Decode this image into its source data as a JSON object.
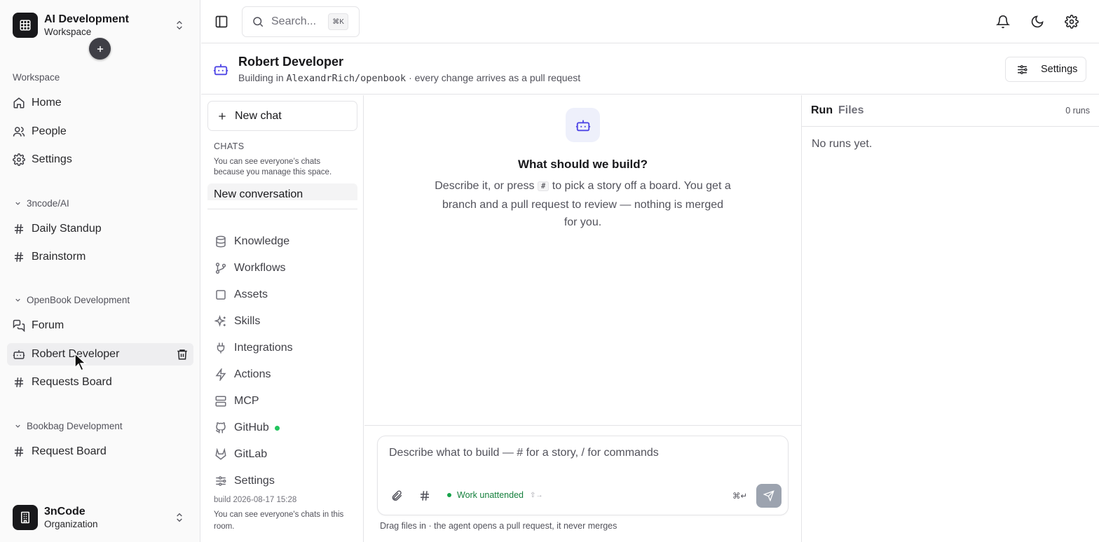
{
  "workspace": {
    "name": "AI Development",
    "type": "Workspace"
  },
  "sidebar": {
    "section_label": "Workspace",
    "items": [
      {
        "label": "Home",
        "icon": "home-icon"
      },
      {
        "label": "People",
        "icon": "people-icon"
      },
      {
        "label": "Settings",
        "icon": "gear-icon"
      }
    ],
    "groups": [
      {
        "label": "3ncode/AI",
        "items": [
          {
            "label": "Daily Standup",
            "icon": "hash-icon"
          },
          {
            "label": "Brainstorm",
            "icon": "hash-icon"
          }
        ]
      },
      {
        "label": "OpenBook Development",
        "items": [
          {
            "label": "Forum",
            "icon": "forum-icon"
          },
          {
            "label": "Robert Developer",
            "icon": "bot-icon",
            "active": true
          },
          {
            "label": "Requests Board",
            "icon": "hash-icon"
          }
        ]
      },
      {
        "label": "Bookbag Development",
        "items": [
          {
            "label": "Request Board",
            "icon": "hash-icon"
          }
        ]
      }
    ]
  },
  "organization": {
    "name": "3nCode",
    "type": "Organization"
  },
  "topbar": {
    "search_placeholder": "Search...",
    "search_shortcut": "⌘K"
  },
  "header": {
    "title": "Robert Developer",
    "subtitle_prefix": "Building in",
    "repo": "AlexandrRich/openbook",
    "subtitle_suffix": "· every change arrives as a pull request",
    "settings_label": "Settings"
  },
  "chats": {
    "new_chat_label": "New chat",
    "section_label": "CHATS",
    "note": "You can see everyone’s chats because you manage this space.",
    "items": [
      {
        "label": "New conversation"
      }
    ]
  },
  "tools": [
    {
      "label": "Knowledge",
      "icon": "database-icon"
    },
    {
      "label": "Workflows",
      "icon": "git-branch-icon"
    },
    {
      "label": "Assets",
      "icon": "square-icon"
    },
    {
      "label": "Skills",
      "icon": "sparkles-icon"
    },
    {
      "label": "Integrations",
      "icon": "plug-icon"
    },
    {
      "label": "Actions",
      "icon": "zap-icon"
    },
    {
      "label": "MCP",
      "icon": "server-icon"
    },
    {
      "label": "GitHub",
      "icon": "github-icon",
      "status": "connected"
    },
    {
      "label": "GitLab",
      "icon": "gitlab-icon"
    },
    {
      "label": "Settings",
      "icon": "sliders-icon"
    }
  ],
  "build_info": "build 2026-08-17 15:28",
  "room_note": "You can see everyone's chats in this room.",
  "main": {
    "title": "What should we build?",
    "desc_before": "Describe it, or press",
    "desc_key": "#",
    "desc_after": "to pick a story off a board. You get a branch and a pull request to review — nothing is merged for you.",
    "composer_placeholder": "Describe what to build — # for a story, / for commands",
    "work_unattended": "Work unattended",
    "work_shortcut": "⇧→",
    "send_shortcut": "⌘↵",
    "footer_note": "Drag files in · the agent opens a pull request, it never merges"
  },
  "right_panel": {
    "tabs": [
      {
        "label": "Run",
        "active": true
      },
      {
        "label": "Files",
        "active": false
      }
    ],
    "runs_count": "0 runs",
    "empty_text": "No runs yet."
  },
  "colors": {
    "accent": "#4f46e5",
    "status_green": "#16a34a",
    "send_disabled": "#9ca3af"
  }
}
